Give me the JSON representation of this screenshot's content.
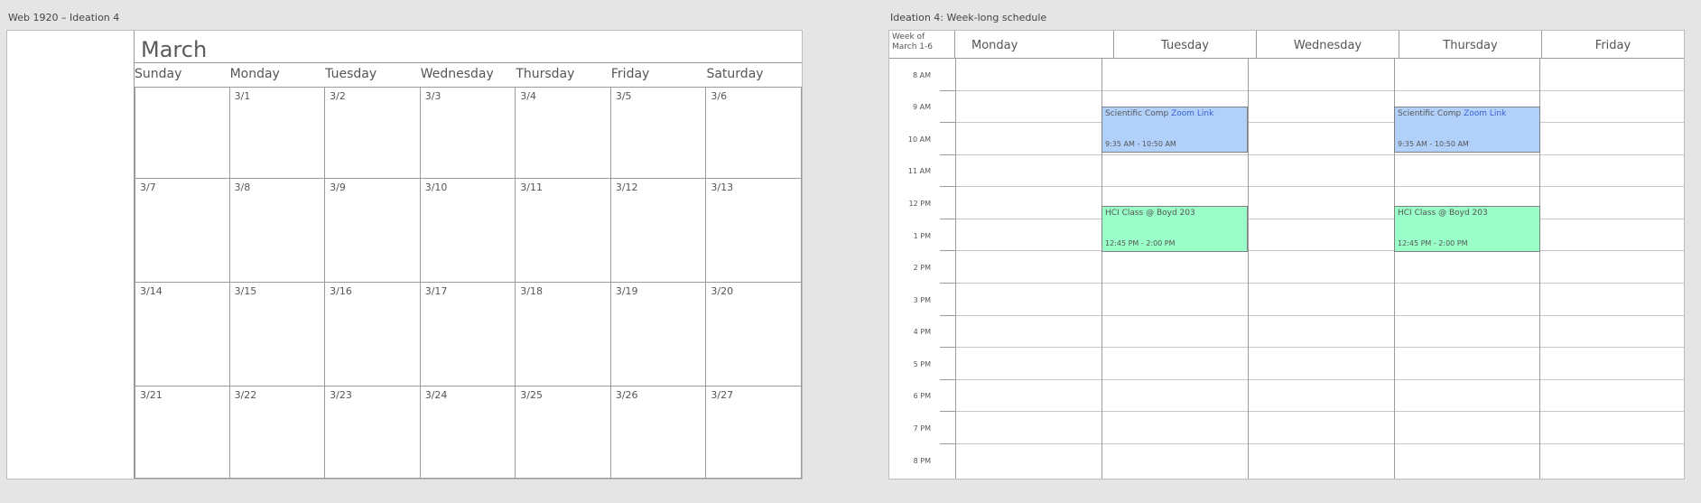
{
  "month_frame": {
    "frame_title": "Web 1920 – Ideation 4",
    "title": "March",
    "day_names": [
      "Sunday",
      "Monday",
      "Tuesday",
      "Wednesday",
      "Thursday",
      "Friday",
      "Saturday"
    ],
    "weeks": [
      [
        "",
        "3/1",
        "3/2",
        "3/3",
        "3/4",
        "3/5",
        "3/6"
      ],
      [
        "3/7",
        "3/8",
        "3/9",
        "3/10",
        "3/11",
        "3/12",
        "3/13"
      ],
      [
        "3/14",
        "3/15",
        "3/16",
        "3/17",
        "3/18",
        "3/19",
        "3/20"
      ],
      [
        "3/21",
        "3/22",
        "3/23",
        "3/24",
        "3/25",
        "3/26",
        "3/27"
      ]
    ]
  },
  "week_frame": {
    "frame_title": "Ideation 4: Week-long schedule",
    "corner_line1": "Week of",
    "corner_line2": "March 1-6",
    "days": [
      "Monday",
      "Tuesday",
      "Wednesday",
      "Thursday",
      "Friday"
    ],
    "times": [
      "8 AM",
      "9 AM",
      "10 AM",
      "11 AM",
      "12 PM",
      "1 PM",
      "2 PM",
      "3 PM",
      "4 PM",
      "5 PM",
      "6 PM",
      "7 PM",
      "8 PM"
    ],
    "events": [
      {
        "title": "Scientific Comp",
        "link": "Zoom Link",
        "time": "9:35 AM - 10:50 AM",
        "color": "#b1d1fb"
      },
      {
        "title": "Scientific Comp",
        "link": "Zoom Link",
        "time": "9:35 AM - 10:50 AM",
        "color": "#b1d1fb"
      },
      {
        "title": "HCI Class @ Boyd 203",
        "link": "",
        "time": "12:45 PM - 2:00 PM",
        "color": "#99fec8"
      },
      {
        "title": "HCI Class @ Boyd 203",
        "link": "",
        "time": "12:45 PM - 2:00 PM",
        "color": "#99fec8"
      }
    ]
  }
}
